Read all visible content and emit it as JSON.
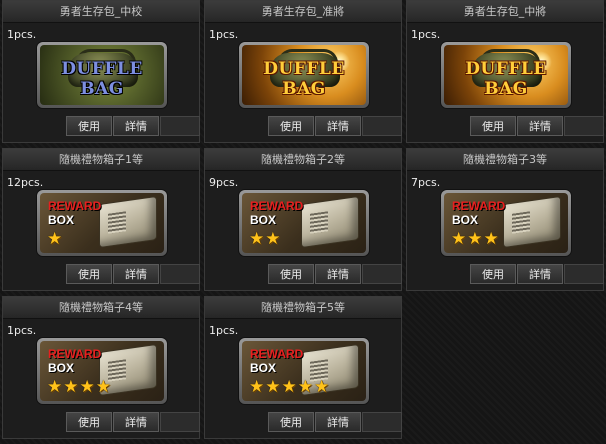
{
  "items": [
    {
      "title": "勇者生存包_中校",
      "qty": "1pcs.",
      "icon": "duffle-bag-icon",
      "art": "DUFFLE BAG",
      "style": "green",
      "use_label": "使用",
      "detail_label": "詳情"
    },
    {
      "title": "勇者生存包_准將",
      "qty": "1pcs.",
      "icon": "duffle-bag-icon",
      "art": "DUFFLE BAG",
      "style": "orange",
      "use_label": "使用",
      "detail_label": "詳情"
    },
    {
      "title": "勇者生存包_中將",
      "qty": "1pcs.",
      "icon": "duffle-bag-icon",
      "art": "DUFFLE BAG",
      "style": "orange",
      "use_label": "使用",
      "detail_label": "詳情"
    },
    {
      "title": "隨機禮物箱子1等",
      "qty": "12pcs.",
      "icon": "reward-box-icon",
      "art_top": "REWARD",
      "art_bottom": "BOX",
      "stars": 1,
      "use_label": "使用",
      "detail_label": "詳情"
    },
    {
      "title": "隨機禮物箱子2等",
      "qty": "9pcs.",
      "icon": "reward-box-icon",
      "art_top": "REWARD",
      "art_bottom": "BOX",
      "stars": 2,
      "use_label": "使用",
      "detail_label": "詳情"
    },
    {
      "title": "隨機禮物箱子3等",
      "qty": "7pcs.",
      "icon": "reward-box-icon",
      "art_top": "REWARD",
      "art_bottom": "BOX",
      "stars": 3,
      "use_label": "使用",
      "detail_label": "詳情"
    },
    {
      "title": "隨機禮物箱子4等",
      "qty": "1pcs.",
      "icon": "reward-box-icon",
      "art_top": "REWARD",
      "art_bottom": "BOX",
      "stars": 4,
      "use_label": "使用",
      "detail_label": "詳情"
    },
    {
      "title": "隨機禮物箱子5等",
      "qty": "1pcs.",
      "icon": "reward-box-icon",
      "art_top": "REWARD",
      "art_bottom": "BOX",
      "stars": 5,
      "use_label": "使用",
      "detail_label": "詳情"
    }
  ]
}
